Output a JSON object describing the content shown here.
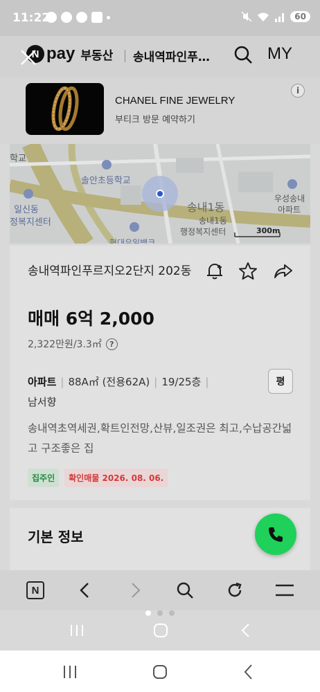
{
  "status_bar": {
    "time": "11:22",
    "battery": "60",
    "icons": [
      "talk-icon",
      "message-icon",
      "sms-icon",
      "b-icon",
      "dot-icon",
      "mute-icon",
      "wifi-icon",
      "signal-icon",
      "battery-icon"
    ]
  },
  "header": {
    "logo_n": "N",
    "logo_pay": "pay",
    "service": "부동산",
    "title": "송내역파인푸…",
    "my_label": "MY"
  },
  "ad": {
    "title": "CHANEL FINE JEWELRY",
    "subtitle": "부티크 방문 예약하기",
    "info": "i"
  },
  "map": {
    "labels": {
      "school_left": "학교",
      "school": "솔안초등학교",
      "center_left_1": "일신동",
      "center_left_2": "정복지센터",
      "dong": "송내1동",
      "dong_center_1": "송내1동",
      "dong_center_2": "행정복지센터",
      "apt_1": "우성송내",
      "apt_2": "아파트",
      "bank": "현대우일뱅크"
    },
    "scale": "300m"
  },
  "listing": {
    "name": "송내역파인푸르지오2단지 202동",
    "price": "매매 6억 2,000",
    "unit_price": "2,322만원/3.3㎡",
    "help": "?",
    "type": "아파트",
    "area": "88A㎡ (전용62A)",
    "floor": "19/25층",
    "pyeong_button": "평",
    "direction": "남서향",
    "description": "송내역초역세권,확트인전망,산뷰,일조권은 최고,수납공간넓고 구조좋은 집",
    "tags": [
      "집주인",
      "확인매물 2026. 08. 06."
    ]
  },
  "basic_info": {
    "title": "기본 정보"
  },
  "colors": {
    "call_button": "#1fd15a",
    "tag_green": "#1f8a3c",
    "tag_red": "#d33a3a"
  }
}
